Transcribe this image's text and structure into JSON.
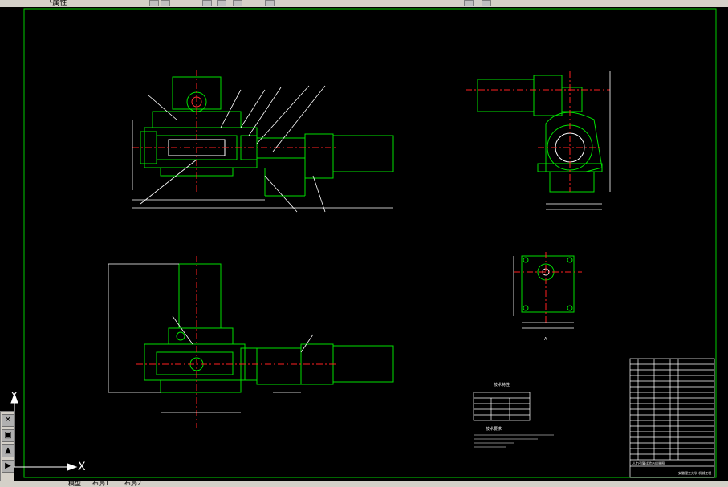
{
  "toolbar": {
    "layer_text": "└属性",
    "colors": {
      "bg": "#d4d0c8"
    }
  },
  "canvas": {
    "background": "#000000",
    "frame_color": "#00cc00",
    "centerline_color": "#ff2020",
    "line_color": "#ffffff"
  },
  "drawing": {
    "tech_req_title": "技术要求",
    "tech_params_title": "技术特性",
    "view_scale_label": "A",
    "title_block_name": "人力引擎试验台组装图",
    "title_block_company": "安徽理工大学 机械工程"
  },
  "ucs": {
    "x_label": "X",
    "y_label": "Y"
  },
  "tabs": {
    "model": "模型",
    "layout1": "布局1",
    "layout2": "布局2"
  },
  "left_palette": {
    "icons": [
      "close-icon",
      "properties-icon",
      "layers-icon",
      "tool-icon"
    ]
  }
}
